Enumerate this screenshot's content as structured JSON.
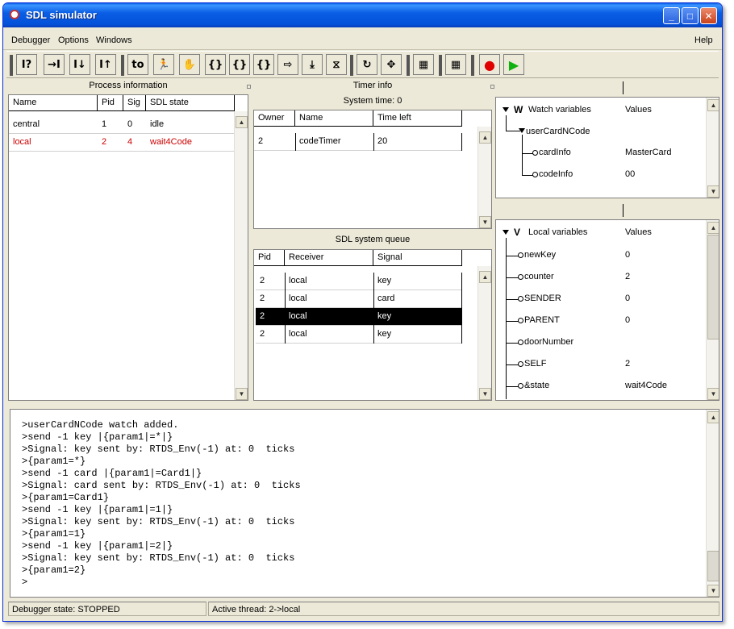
{
  "window": {
    "title": "SDL simulator"
  },
  "menu": {
    "debugger": "Debugger",
    "options": "Options",
    "windows": "Windows",
    "help": "Help"
  },
  "toolbar": {
    "buttons": [
      {
        "icon": "process-info-icon",
        "glyph": "I?"
      },
      {
        "icon": "step-into-icon",
        "glyph": "→I"
      },
      {
        "icon": "step-over-icon",
        "glyph": "I↓"
      },
      {
        "icon": "step-out-icon",
        "glyph": "I↑"
      },
      {
        "icon": "send-to-icon",
        "glyph": "to"
      },
      {
        "icon": "run-man-icon",
        "glyph": "🏃"
      },
      {
        "icon": "hand-stop-icon",
        "glyph": "✋"
      },
      {
        "icon": "step-transition-icon",
        "glyph": "{}"
      },
      {
        "icon": "next-transition-icon",
        "glyph": "{}"
      },
      {
        "icon": "step-statement-icon",
        "glyph": "{}"
      },
      {
        "icon": "next-state-icon",
        "glyph": "⇨"
      },
      {
        "icon": "deliver-icon",
        "glyph": "⤓"
      },
      {
        "icon": "timer-icon",
        "glyph": "⧖"
      },
      {
        "icon": "refresh-icon",
        "glyph": "↻"
      },
      {
        "icon": "move-icon",
        "glyph": "✥"
      },
      {
        "icon": "msc-trace-icon",
        "glyph": "▦"
      },
      {
        "icon": "calculator-icon",
        "glyph": "▦"
      },
      {
        "icon": "record-icon",
        "glyph": "●"
      },
      {
        "icon": "play-icon",
        "glyph": "▶"
      }
    ]
  },
  "process_info": {
    "title": "Process information",
    "columns": [
      "Name",
      "Pid",
      "Sig",
      "SDL state"
    ],
    "rows": [
      {
        "name": "central",
        "pid": "1",
        "sig": "0",
        "state": "idle",
        "highlight": false
      },
      {
        "name": "local",
        "pid": "2",
        "sig": "4",
        "state": "wait4Code",
        "highlight": true
      }
    ]
  },
  "timer_info": {
    "title": "Timer info",
    "system_time": "System time: 0",
    "columns": [
      "Owner",
      "Name",
      "Time left"
    ],
    "rows": [
      {
        "owner": "2",
        "name": "codeTimer",
        "time_left": "20"
      }
    ]
  },
  "queue": {
    "title": "SDL system queue",
    "columns": [
      "Pid",
      "Receiver",
      "Signal"
    ],
    "rows": [
      {
        "pid": "2",
        "receiver": "local",
        "signal": "key"
      },
      {
        "pid": "2",
        "receiver": "local",
        "signal": "card"
      },
      {
        "pid": "2",
        "receiver": "local",
        "signal": "key"
      },
      {
        "pid": "2",
        "receiver": "local",
        "signal": "key"
      }
    ],
    "selected_index": 2
  },
  "watch": {
    "root_letter": "W",
    "root_label": "Watch variables",
    "values_header": "Values",
    "group": "userCardNCode",
    "items": [
      {
        "name": "cardInfo",
        "value": "MasterCard"
      },
      {
        "name": "codeInfo",
        "value": "00"
      }
    ]
  },
  "locals": {
    "root_letter": "V",
    "root_label": "Local variables",
    "values_header": "Values",
    "items": [
      {
        "name": "newKey",
        "value": "0"
      },
      {
        "name": "counter",
        "value": "2"
      },
      {
        "name": "SENDER",
        "value": "0"
      },
      {
        "name": "PARENT",
        "value": "0"
      },
      {
        "name": "doorNumber",
        "value": ""
      },
      {
        "name": "SELF",
        "value": "2"
      },
      {
        "name": "&state",
        "value": "wait4Code"
      }
    ]
  },
  "console": {
    "lines": [
      ">userCardNCode watch added.",
      ">send -1 key |{param1|=*|}",
      ">Signal: key sent by: RTDS_Env(-1) at: 0  ticks",
      ">{param1=*}",
      ">send -1 card |{param1|=Card1|}",
      ">Signal: card sent by: RTDS_Env(-1) at: 0  ticks",
      ">{param1=Card1}",
      ">send -1 key |{param1|=1|}",
      ">Signal: key sent by: RTDS_Env(-1) at: 0  ticks",
      ">{param1=1}",
      ">send -1 key |{param1|=2|}",
      ">Signal: key sent by: RTDS_Env(-1) at: 0  ticks",
      ">{param1=2}",
      ">"
    ]
  },
  "status": {
    "debugger_state": "Debugger state: STOPPED",
    "active_thread": "Active thread: 2->local"
  },
  "colors": {
    "highlight_red": "#cc0000",
    "selected_row": "#000000",
    "titlebar": "#0a5ee4"
  }
}
